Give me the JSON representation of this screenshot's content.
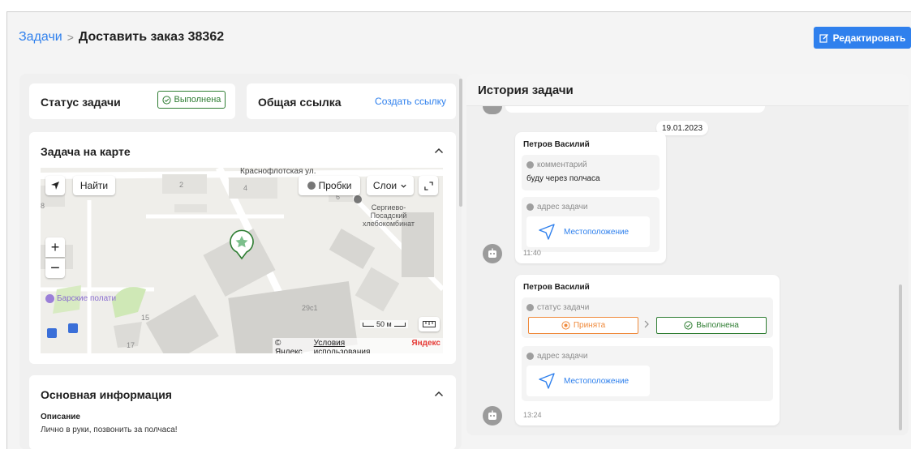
{
  "header": {
    "breadcrumb_parent": "Задачи",
    "breadcrumb_separator": ">",
    "breadcrumb_current": "Доставить заказ 38362",
    "edit_label": "Редактировать"
  },
  "status_card": {
    "title": "Статус задачи",
    "badge": "Выполнена"
  },
  "link_card": {
    "title": "Общая ссылка",
    "action": "Создать ссылку"
  },
  "map_card": {
    "title": "Задача на карте",
    "find_label": "Найти",
    "traffic_label": "Пробки",
    "layers_label": "Слои",
    "street_label": "Краснофлотская ул.",
    "house_numbers": [
      "2",
      "4",
      "6",
      "8",
      "15",
      "17",
      "29с1"
    ],
    "poi_bakery": "Сергиево-\nПосадский\nхлебокомбинат",
    "poi_hotel": "Барские полати",
    "scale_label": "50 м",
    "copyright": "© Яндекс",
    "terms_link": "Условия использования",
    "brand": "Яндекс"
  },
  "info_card": {
    "title": "Основная информация",
    "desc_label": "Описание",
    "desc_text": "Лично в руки, позвонить за полчаса!"
  },
  "history": {
    "title": "История задачи",
    "date_chip": "19.01.2023",
    "messages": [
      {
        "author": "Петров Василий",
        "comment_label": "комментарий",
        "comment_text": "буду через полчаса",
        "address_label": "адрес задачи",
        "location_label": "Местоположение",
        "time": "11:40"
      },
      {
        "author": "Петров Василий",
        "status_label": "статус задачи",
        "status_from": "Принята",
        "status_to": "Выполнена",
        "address_label": "адрес задачи",
        "location_label": "Местоположение",
        "time": "13:24"
      }
    ]
  },
  "colors": {
    "accent": "#2f80ed",
    "success": "#2e7d32",
    "warning": "#ef8a3c",
    "panel": "#f0f0f0"
  }
}
